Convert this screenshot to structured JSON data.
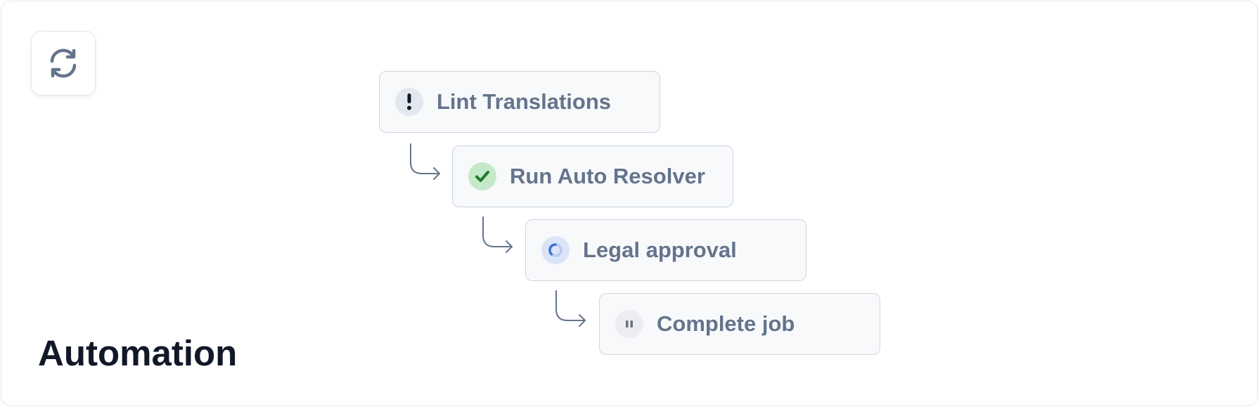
{
  "app": {
    "title": "Automation",
    "icon": "refresh-icon"
  },
  "workflow": {
    "steps": [
      {
        "label": "Lint Translations",
        "status": "warning",
        "icon": "exclamation-icon"
      },
      {
        "label": "Run Auto Resolver",
        "status": "complete",
        "icon": "checkmark-icon"
      },
      {
        "label": "Legal approval",
        "status": "in-progress",
        "icon": "spinner-icon"
      },
      {
        "label": "Complete job",
        "status": "paused",
        "icon": "pause-icon"
      }
    ]
  },
  "colors": {
    "title": "#111827",
    "step_label": "#64748b",
    "step_border": "#cdd5e0",
    "warning_dot": "#0f172a",
    "complete_check": "#1f7a2e",
    "progress_blue": "#3b6fd8",
    "paused_gray": "#6b7280"
  }
}
